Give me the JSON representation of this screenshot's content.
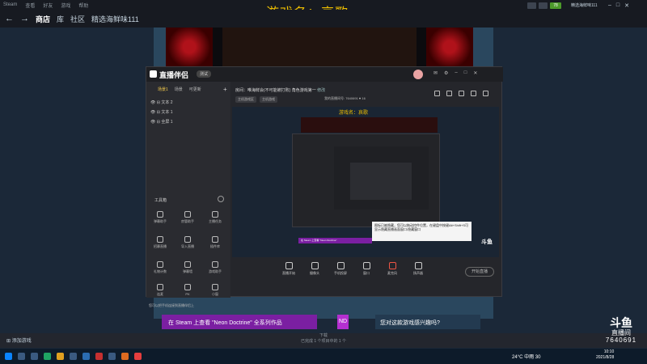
{
  "steam": {
    "menu": [
      "Steam",
      "查看",
      "好友",
      "游戏",
      "帮助"
    ],
    "nav": {
      "store": "商店",
      "library": "库",
      "community": "社区",
      "user": "精选海鲜味111"
    },
    "user_top": "精选海鲜味111",
    "badge": "78",
    "banner": "在 Steam 上查看 \"Neon Doctrine\" 全系列作品",
    "banner_tag": "ND",
    "interest": "您对这款游戏感兴趣吗?",
    "add_game": "添加游戏",
    "downloads": "下载",
    "downloads_sub": "已完成 1 个项目中的 1 个"
  },
  "overlay_title": "游戏名：哀歌",
  "zbw": {
    "app_name": "直播伴侣",
    "badge": "测试",
    "source_tabs": [
      "场景1",
      "场景",
      "可更新"
    ],
    "sources": [
      "文本 2",
      "文本 1",
      "全屏 1"
    ],
    "toolbox": "工具箱",
    "tools": [
      "弹幕助手",
      "房管助手",
      "主播任务",
      "招募直播",
      "导入直播",
      "插件库",
      "礼物计数",
      "弹幕墙",
      "游戏助手",
      "连麦",
      "PK",
      "小窗"
    ],
    "room_title": "房间：唯海鲜会(不可能被打败) 角色游戏第一",
    "edit": "修改",
    "chips": [
      "主机游戏区",
      "主机游戏"
    ],
    "room_num": "我的直播间号: 7640691",
    "fans": "16",
    "preview_title": "游戏名：哀歌",
    "tooltip": "图标已被隐藏，您可以拖动控件位置，在键盘中按键Alt+Shift+S可显示隐藏直播画面窗口/隐藏窗口",
    "purple_bar": "在 Steam 上查看 \"Neon Doctrine\"",
    "bottom_tools": [
      "直播开始",
      "摄像头",
      "手机投屏",
      "窗口",
      "麦克风",
      "扬声器"
    ],
    "start": "开始直播",
    "phone_tip": "您可以把手机连接到直播伴侣上"
  },
  "douyu": {
    "brand": "斗鱼",
    "sub": "直播间",
    "room": "7640691"
  },
  "taskbar": {
    "weather": "24°C 中雨 30",
    "time": "10:10",
    "date": "2021/8/28"
  }
}
